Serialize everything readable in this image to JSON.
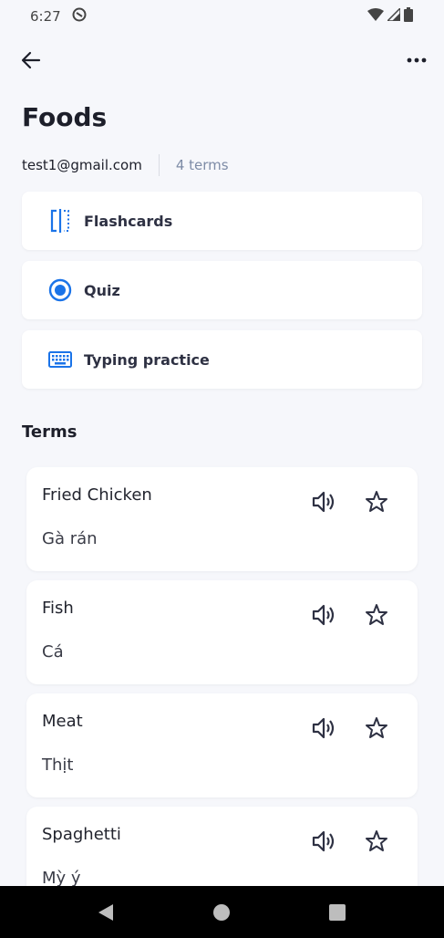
{
  "status_bar": {
    "time": "6:27"
  },
  "header": {
    "title": "Foods"
  },
  "meta": {
    "owner": "test1@gmail.com",
    "term_count": "4 terms"
  },
  "modes": [
    {
      "label": "Flashcards",
      "icon": "flashcards-icon"
    },
    {
      "label": "Quiz",
      "icon": "radio-selected-icon"
    },
    {
      "label": "Typing practice",
      "icon": "keyboard-icon"
    }
  ],
  "terms_section": {
    "title": "Terms"
  },
  "terms": [
    {
      "term": "Fried Chicken",
      "definition": "Gà rán"
    },
    {
      "term": "Fish",
      "definition": "Cá"
    },
    {
      "term": "Meat",
      "definition": "Thịt"
    },
    {
      "term": "Spaghetti",
      "definition": "Mỳ ý"
    }
  ],
  "colors": {
    "accent": "#1a73e8",
    "background": "#f6f7fb",
    "muted_text": "#7d8ba6"
  }
}
